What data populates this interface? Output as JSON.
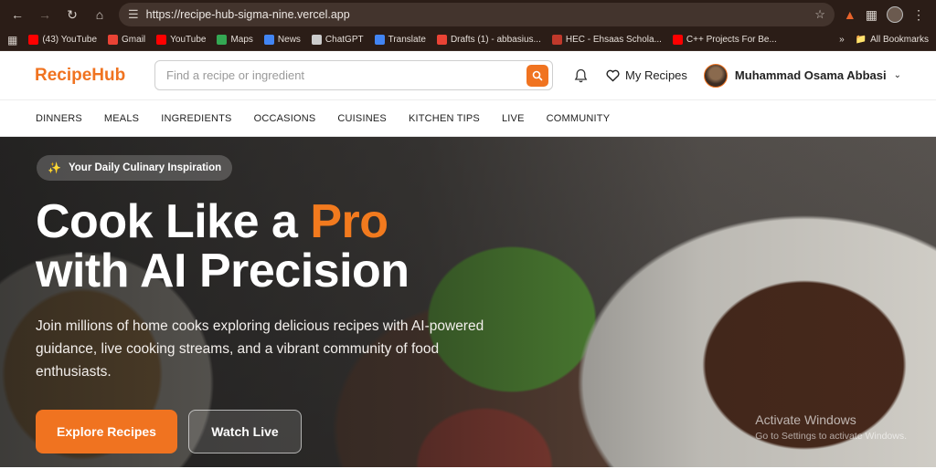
{
  "browser": {
    "url": "https://recipe-hub-sigma-nine.vercel.app",
    "bookmarks": [
      {
        "label": "(43) YouTube",
        "color": "#ff0000"
      },
      {
        "label": "Gmail",
        "color": "#ea4335"
      },
      {
        "label": "YouTube",
        "color": "#ff0000"
      },
      {
        "label": "Maps",
        "color": "#34a853"
      },
      {
        "label": "News",
        "color": "#4285f4"
      },
      {
        "label": "ChatGPT",
        "color": "#cccccc"
      },
      {
        "label": "Translate",
        "color": "#4285f4"
      },
      {
        "label": "Drafts (1) - abbasius...",
        "color": "#ea4335"
      },
      {
        "label": "HEC - Ehsaas Schola...",
        "color": "#c0392b"
      },
      {
        "label": "C++ Projects For Be...",
        "color": "#ff0000"
      }
    ],
    "all_bookmarks": "All Bookmarks",
    "overflow": "»"
  },
  "header": {
    "logo": "RecipeHub",
    "search_placeholder": "Find a recipe or ingredient",
    "my_recipes": "My Recipes",
    "user_name": "Muhammad Osama Abbasi"
  },
  "nav": [
    "DINNERS",
    "MEALS",
    "INGREDIENTS",
    "OCCASIONS",
    "CUISINES",
    "KITCHEN TIPS",
    "LIVE",
    "COMMUNITY"
  ],
  "hero": {
    "pill": "Your Daily Culinary Inspiration",
    "title_part1": "Cook Like a ",
    "title_accent": "Pro",
    "title_line2": "with AI Precision",
    "subtitle": "Join millions of home cooks exploring delicious recipes with AI-powered guidance, live cooking streams, and a vibrant community of food enthusiasts.",
    "explore_button": "Explore Recipes",
    "watch_button": "Watch Live"
  },
  "watermark": {
    "title": "Activate Windows",
    "subtitle": "Go to Settings to activate Windows."
  },
  "colors": {
    "accent": "#f07320",
    "chrome": "#2b1d17"
  }
}
